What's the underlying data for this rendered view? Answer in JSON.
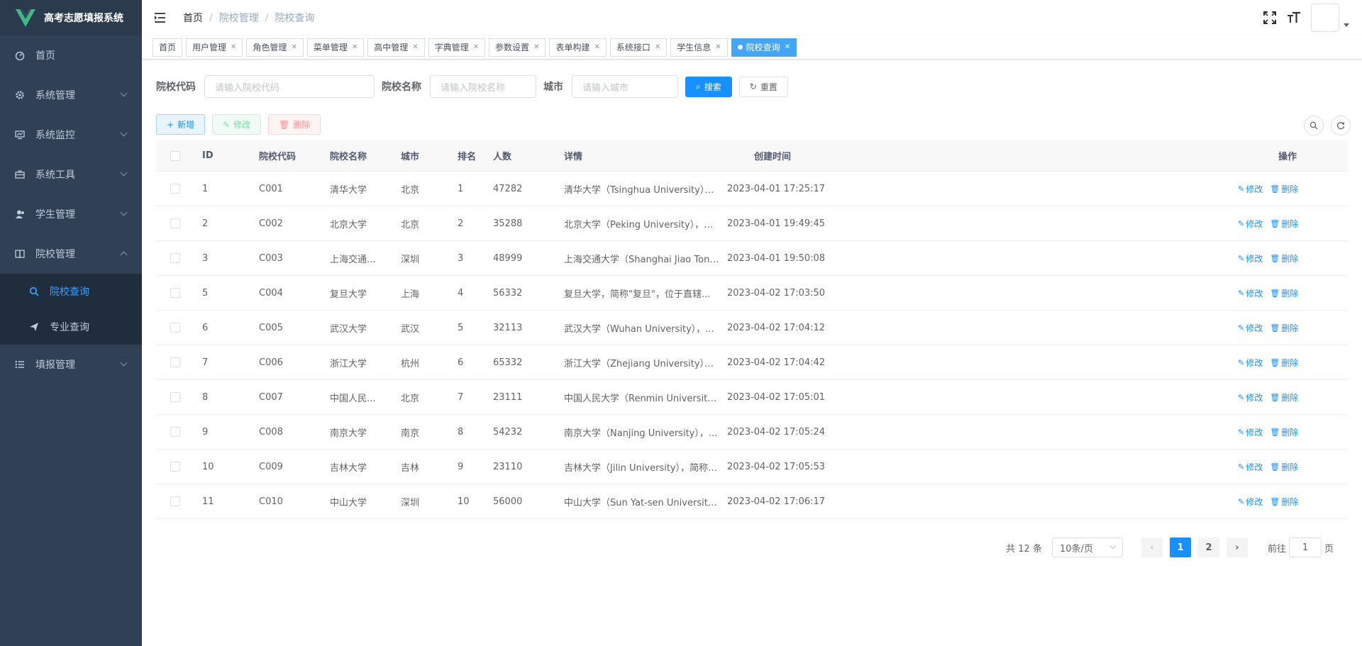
{
  "app": {
    "title": "高考志愿填报系统"
  },
  "sidebar": {
    "items": [
      {
        "label": "首页",
        "icon": "dashboard-icon"
      },
      {
        "label": "系统管理",
        "icon": "gear-icon"
      },
      {
        "label": "系统监控",
        "icon": "monitor-icon"
      },
      {
        "label": "系统工具",
        "icon": "toolbox-icon"
      },
      {
        "label": "学生管理",
        "icon": "user-icon"
      },
      {
        "label": "院校管理",
        "icon": "book-icon",
        "expanded": true
      }
    ],
    "sub_items": [
      {
        "label": "院校查询",
        "icon": "search-icon",
        "active": true
      },
      {
        "label": "专业查询",
        "icon": "paper-plane-icon"
      }
    ],
    "last_item": {
      "label": "填报管理",
      "icon": "list-icon"
    }
  },
  "breadcrumb": [
    "首页",
    "院校管理",
    "院校查询"
  ],
  "tags": [
    {
      "label": "首页",
      "closable": false
    },
    {
      "label": "用户管理",
      "closable": true
    },
    {
      "label": "角色管理",
      "closable": true
    },
    {
      "label": "菜单管理",
      "closable": true
    },
    {
      "label": "高中管理",
      "closable": true
    },
    {
      "label": "字典管理",
      "closable": true
    },
    {
      "label": "参数设置",
      "closable": true
    },
    {
      "label": "表单构建",
      "closable": true
    },
    {
      "label": "系统接口",
      "closable": true
    },
    {
      "label": "学生信息",
      "closable": true
    },
    {
      "label": "院校查询",
      "closable": true,
      "active": true
    }
  ],
  "search": {
    "code_label": "院校代码",
    "code_placeholder": "请输入院校代码",
    "name_label": "院校名称",
    "name_placeholder": "请输入院校名称",
    "city_label": "城市",
    "city_placeholder": "请输入城市",
    "search_btn": "搜索",
    "reset_btn": "重置"
  },
  "toolbar": {
    "add": "新增",
    "edit": "修改",
    "delete": "删除"
  },
  "table": {
    "headers": [
      "ID",
      "院校代码",
      "院校名称",
      "城市",
      "排名",
      "人数",
      "详情",
      "创建时间",
      "操作"
    ],
    "op_edit": "修改",
    "op_delete": "删除",
    "rows": [
      [
        "1",
        "C001",
        "清华大学",
        "北京",
        "1",
        "47282",
        "清华大学（Tsinghua University），...",
        "2023-04-01 17:25:17"
      ],
      [
        "2",
        "C002",
        "北京大学",
        "北京",
        "2",
        "35288",
        "北京大学（Peking University），简...",
        "2023-04-01 19:49:45"
      ],
      [
        "3",
        "C003",
        "上海交通...",
        "深圳",
        "3",
        "48999",
        "上海交通大学（Shanghai Jiao Tong...",
        "2023-04-01 19:50:08"
      ],
      [
        "5",
        "C004",
        "复旦大学",
        "上海",
        "4",
        "56332",
        "复旦大学，简称\"复旦\"，位于直辖...",
        "2023-04-02 17:03:50"
      ],
      [
        "6",
        "C005",
        "武汉大学",
        "武汉",
        "5",
        "32113",
        "武汉大学（Wuhan University），...",
        "2023-04-02 17:04:12"
      ],
      [
        "7",
        "C006",
        "浙江大学",
        "杭州",
        "6",
        "65332",
        "浙江大学（Zhejiang University），...",
        "2023-04-02 17:04:42"
      ],
      [
        "8",
        "C007",
        "中国人民...",
        "北京",
        "7",
        "23111",
        "中国人民大学（Renmin University ...",
        "2023-04-02 17:05:01"
      ],
      [
        "9",
        "C008",
        "南京大学",
        "南京",
        "8",
        "54232",
        "南京大学（Nanjing University），...",
        "2023-04-02 17:05:24"
      ],
      [
        "10",
        "C009",
        "吉林大学",
        "吉林",
        "9",
        "23110",
        "吉林大学（Jilin University），简称\"...",
        "2023-04-02 17:05:53"
      ],
      [
        "11",
        "C010",
        "中山大学",
        "深圳",
        "10",
        "56000",
        "中山大学（Sun Yat-sen University...",
        "2023-04-02 17:06:17"
      ]
    ]
  },
  "pagination": {
    "total": "共 12 条",
    "page_size": "10条/页",
    "pages": [
      "1",
      "2"
    ],
    "current": "1",
    "goto_prefix": "前往",
    "goto_value": "1",
    "goto_suffix": "页"
  },
  "colors": {
    "sidebar_bg": "#304156",
    "primary": "#1890ff",
    "active_tag": "#42a5f5"
  }
}
